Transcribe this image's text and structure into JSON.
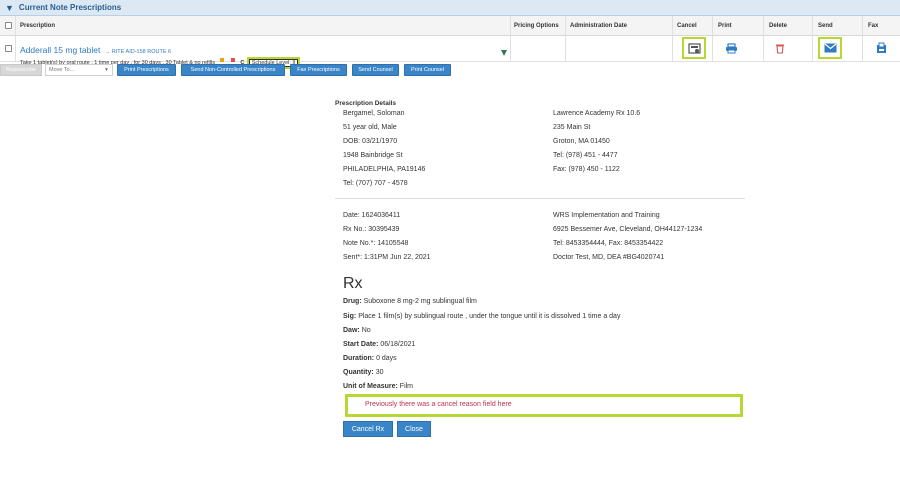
{
  "panel": {
    "title": "Current Note Prescriptions"
  },
  "columns": {
    "prescription": "Prescription",
    "pricing_options": "Pricing Options",
    "administration_date": "Administration Date",
    "cancel": "Cancel",
    "print": "Print",
    "delete": "Delete",
    "send": "Send",
    "fax": "Fax"
  },
  "row": {
    "drug_name": "Adderall 15 mg tablet",
    "pharmacy": "→ RITE AID-158 ROUTE 6",
    "sig": "Take 1 tablet(s) by oral route , 1 time per day , for 30 days , 30 Tablet & no refills",
    "flag_label": "C",
    "schedule_level": "Schedule Level: II"
  },
  "toolbar": {
    "represcribe": "Represcribe",
    "move_to": "Move To...",
    "print_prescriptions": "Print Prescriptions",
    "send_non_controlled": "Send Non-Controlled Prescriptions",
    "fax_prescriptions": "Fax Prescriptions",
    "send_counsel": "Send Counsel",
    "print_counsel": "Print Counsel"
  },
  "details": {
    "heading": "Prescription Details",
    "patient": {
      "name": "Bergamel, Soloman",
      "age_sex": "51 year old, Male",
      "dob": "DOB: 03/21/1970",
      "street": "1948 Bainbridge St",
      "city": "PHILADELPHIA, PA19146",
      "tel": "Tel: (707) 707 - 4578"
    },
    "pharmacy": {
      "name": "Lawrence Academy Rx 10.6",
      "street": "235 Main St",
      "city": "Groton, MA 01450",
      "tel": "Tel: (978) 451 - 4477",
      "fax": "Fax: (978) 450 - 1122"
    },
    "meta": {
      "date": "Date: 1624036411",
      "rx_no": "Rx No.: 30395439",
      "note_no": "Note No.*: 14105548",
      "sent": "Sent*: 1:31PM Jun 22, 2021"
    },
    "prescriber": {
      "org": "WRS Implementation and Training",
      "address": "6925 Bessemer Ave, Cleveland, OH44127-1234",
      "tel_fax": "Tel: 8453354444, Fax: 8453354422",
      "doctor": "Doctor Test, MD, DEA #BG4020741"
    }
  },
  "rx": {
    "title": "Rx",
    "drug_label": "Drug:",
    "drug": "Suboxone 8 mg-2 mg sublingual film",
    "sig_label": "Sig:",
    "sig": "Place 1 film(s) by sublingual route , under the tongue until it is dissolved 1 time a day",
    "daw_label": "Daw:",
    "daw": "No",
    "start_label": "Start Date:",
    "start": "06/18/2021",
    "duration_label": "Duration:",
    "duration": "0 days",
    "quantity_label": "Quantity:",
    "quantity": "30",
    "uom_label": "Unit of Measure:",
    "uom": "Film",
    "cancel_reason_note": "Previously there was a cancel reason field here",
    "cancel_button": "Cancel Rx",
    "close_button": "Close"
  },
  "colors": {
    "accent_blue": "#3a85c8",
    "highlight_green": "#b5d833",
    "link_blue": "#2f7cc2",
    "delete_red": "#d9534f",
    "note_red": "#c0304a"
  }
}
